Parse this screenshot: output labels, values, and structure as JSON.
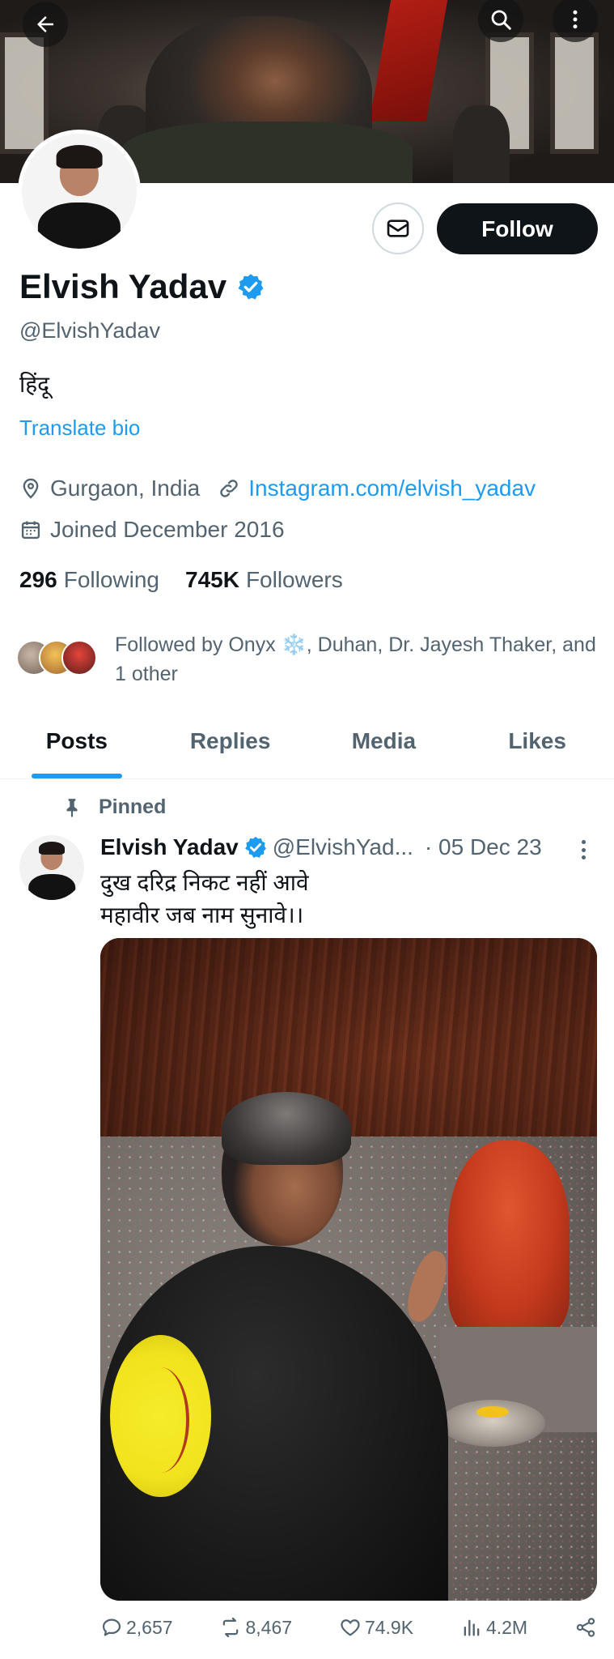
{
  "header": {
    "back_icon": "arrow-left-icon",
    "search_icon": "search-icon",
    "more_icon": "more-vertical-icon"
  },
  "profile": {
    "name": "Elvish Yadav",
    "handle": "@ElvishYadav",
    "bio": "हिंदू",
    "translate_label": "Translate bio",
    "location": "Gurgaon, India",
    "link": "Instagram.com/elvish_yadav",
    "joined": "Joined December 2016",
    "following_count": "296",
    "following_label": "Following",
    "followers_count": "745K",
    "followers_label": "Followers",
    "followed_by": "Followed by Onyx ❄️, Duhan, Dr. Jayesh Thaker, and 1 other",
    "follow_label": "Follow",
    "message_icon": "mail-icon",
    "verified_icon": "verified-badge-icon"
  },
  "tabs": [
    {
      "label": "Posts",
      "active": true
    },
    {
      "label": "Replies",
      "active": false
    },
    {
      "label": "Media",
      "active": false
    },
    {
      "label": "Likes",
      "active": false
    }
  ],
  "pinned_post": {
    "pinned_label": "Pinned",
    "author_name": "Elvish Yadav",
    "author_handle": "@ElvishYad...",
    "date": "· 05 Dec 23",
    "text": "दुख दरिद्र निकट नहीं आवे\nमहावीर जब नाम सुनावे।।",
    "replies": "2,657",
    "reposts": "8,467",
    "likes": "74.9K",
    "views": "4.2M"
  },
  "colors": {
    "accent": "#1d9bf0",
    "text_primary": "#0f1419",
    "text_secondary": "#536471",
    "follow_bg": "#0f1419"
  }
}
